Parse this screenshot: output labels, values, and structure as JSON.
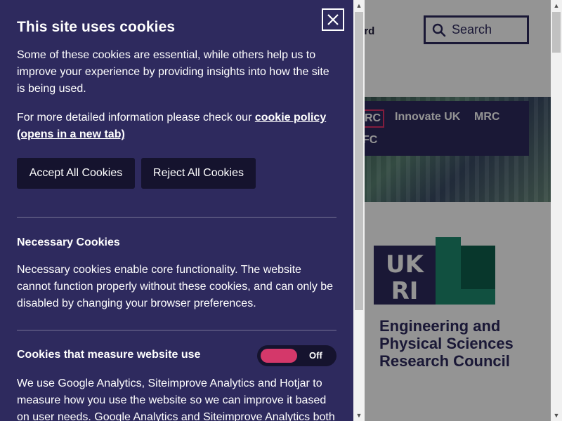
{
  "dialog": {
    "title": "This site uses cookies",
    "intro": "Some of these cookies are essential, while others help us to improve your experience by providing insights into how the site is being used.",
    "detail_prefix": "For more detailed information please check our ",
    "cookie_policy_link": "cookie policy (opens in a new tab)",
    "accept_label": "Accept All Cookies",
    "reject_label": "Reject All Cookies",
    "necessary": {
      "heading": "Necessary Cookies",
      "text": "Necessary cookies enable core functionality. The website cannot function properly without these cookies, and can only be disabled by changing your browser preferences."
    },
    "measurement": {
      "heading": "Cookies that measure website use",
      "toggle_state": "Off",
      "text": "We use Google Analytics, Siteimprove Analytics and Hotjar to measure how you use the website so we can improve it based on user needs. Google Analytics and Siteimprove Analytics both"
    },
    "colors": {
      "background": "#2e2a5e",
      "button": "#15132e",
      "toggle_knob": "#d4386a"
    }
  },
  "site": {
    "header_link": "ard",
    "search_label": "Search",
    "council_nav": [
      "RC",
      "Innovate UK",
      "MRC",
      "FC"
    ],
    "logo_text": "UKRI",
    "council_name": "Engineering and Physical Sciences Research Council",
    "colors": {
      "brand_navy": "#2e2a5e",
      "brand_green": "#1e8a6e",
      "brand_dark_green": "#0f5f4d",
      "active_nav_border": "#e0336a"
    }
  }
}
